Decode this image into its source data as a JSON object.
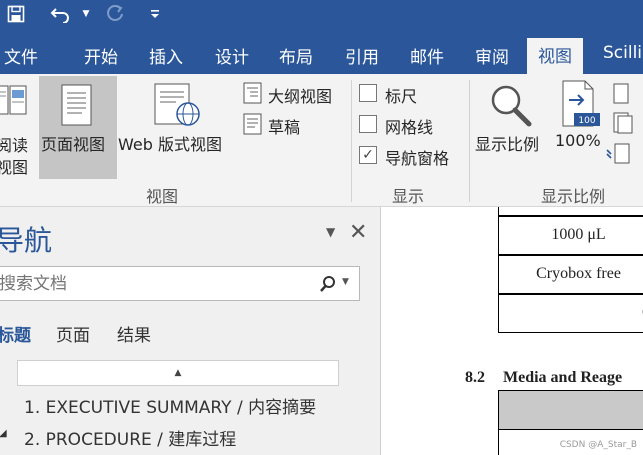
{
  "tabs": [
    "文件",
    "开始",
    "插入",
    "设计",
    "布局",
    "引用",
    "邮件",
    "审阅",
    "视图",
    "Scilli"
  ],
  "views_group": {
    "read_mode": [
      "阅读",
      "视图"
    ],
    "print_layout": "页面视图",
    "web_layout": "Web 版式视图",
    "outline": "大纲视图",
    "draft": "草稿",
    "label": "视图"
  },
  "show_group": {
    "ruler": "标尺",
    "gridlines": "网格线",
    "nav_pane": "导航窗格",
    "ruler_checked": false,
    "gridlines_checked": false,
    "nav_pane_checked": true,
    "label": "显示"
  },
  "zoom_group": {
    "zoom": "显示比例",
    "zoom100": "100%",
    "zoom100_badge": "100",
    "label": "显示比例"
  },
  "nav": {
    "title": "导航",
    "search_placeholder": "搜索文档",
    "tabs": [
      "标题",
      "页面",
      "结果"
    ],
    "headings": [
      "1. EXECUTIVE SUMMARY / 内容摘要",
      "2. PROCEDURE / 建库过程"
    ]
  },
  "doc": {
    "rows": [
      "1000 μL",
      "Cryobox free",
      "Cr"
    ],
    "section_number": "8.2",
    "section_title": "Media and Reage"
  },
  "watermark": "CSDN @A_Star_B",
  "colors": {
    "accent": "#2b579a",
    "ribbon": "#f3f3f3",
    "pane": "#f0f0f0"
  }
}
